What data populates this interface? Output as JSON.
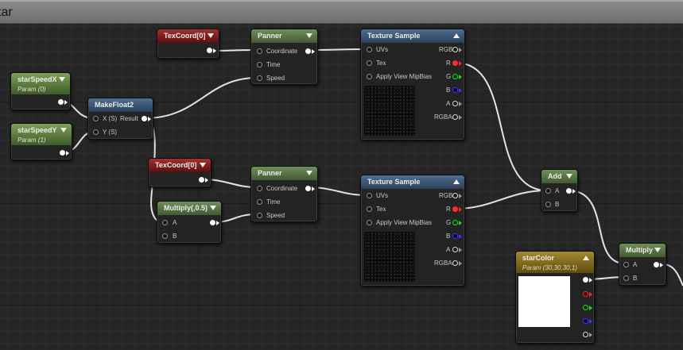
{
  "title": "tar",
  "nodes": {
    "starSpeedX": {
      "title": "starSpeedX",
      "sub": "Param (0)"
    },
    "starSpeedY": {
      "title": "starSpeedY",
      "sub": "Param (1)"
    },
    "makeFloat2": {
      "title": "MakeFloat2",
      "in_x": "X (S)",
      "in_y": "Y (S)",
      "out": "Result"
    },
    "texCoord1": {
      "title": "TexCoord[0]"
    },
    "texCoord2": {
      "title": "TexCoord[0]"
    },
    "panner1": {
      "title": "Panner",
      "coord": "Coordinate",
      "time": "Time",
      "speed": "Speed"
    },
    "panner2": {
      "title": "Panner",
      "coord": "Coordinate",
      "time": "Time",
      "speed": "Speed"
    },
    "multiply05": {
      "title": "Multiply(,0.5)",
      "a": "A",
      "b": "B"
    },
    "texSample1": {
      "title": "Texture Sample",
      "uvs": "UVs",
      "tex": "Tex",
      "mip": "Apply View MipBias",
      "rgb": "RGB",
      "r": "R",
      "g": "G",
      "b": "B",
      "a": "A",
      "rgba": "RGBA"
    },
    "texSample2": {
      "title": "Texture Sample",
      "uvs": "UVs",
      "tex": "Tex",
      "mip": "Apply View MipBias",
      "rgb": "RGB",
      "r": "R",
      "g": "G",
      "b": "B",
      "a": "A",
      "rgba": "RGBA"
    },
    "add": {
      "title": "Add",
      "a": "A",
      "b": "B"
    },
    "multiply": {
      "title": "Multiply",
      "a": "A",
      "b": "B"
    },
    "starColor": {
      "title": "starColor",
      "sub": "Param (30,30,30,1)"
    }
  }
}
